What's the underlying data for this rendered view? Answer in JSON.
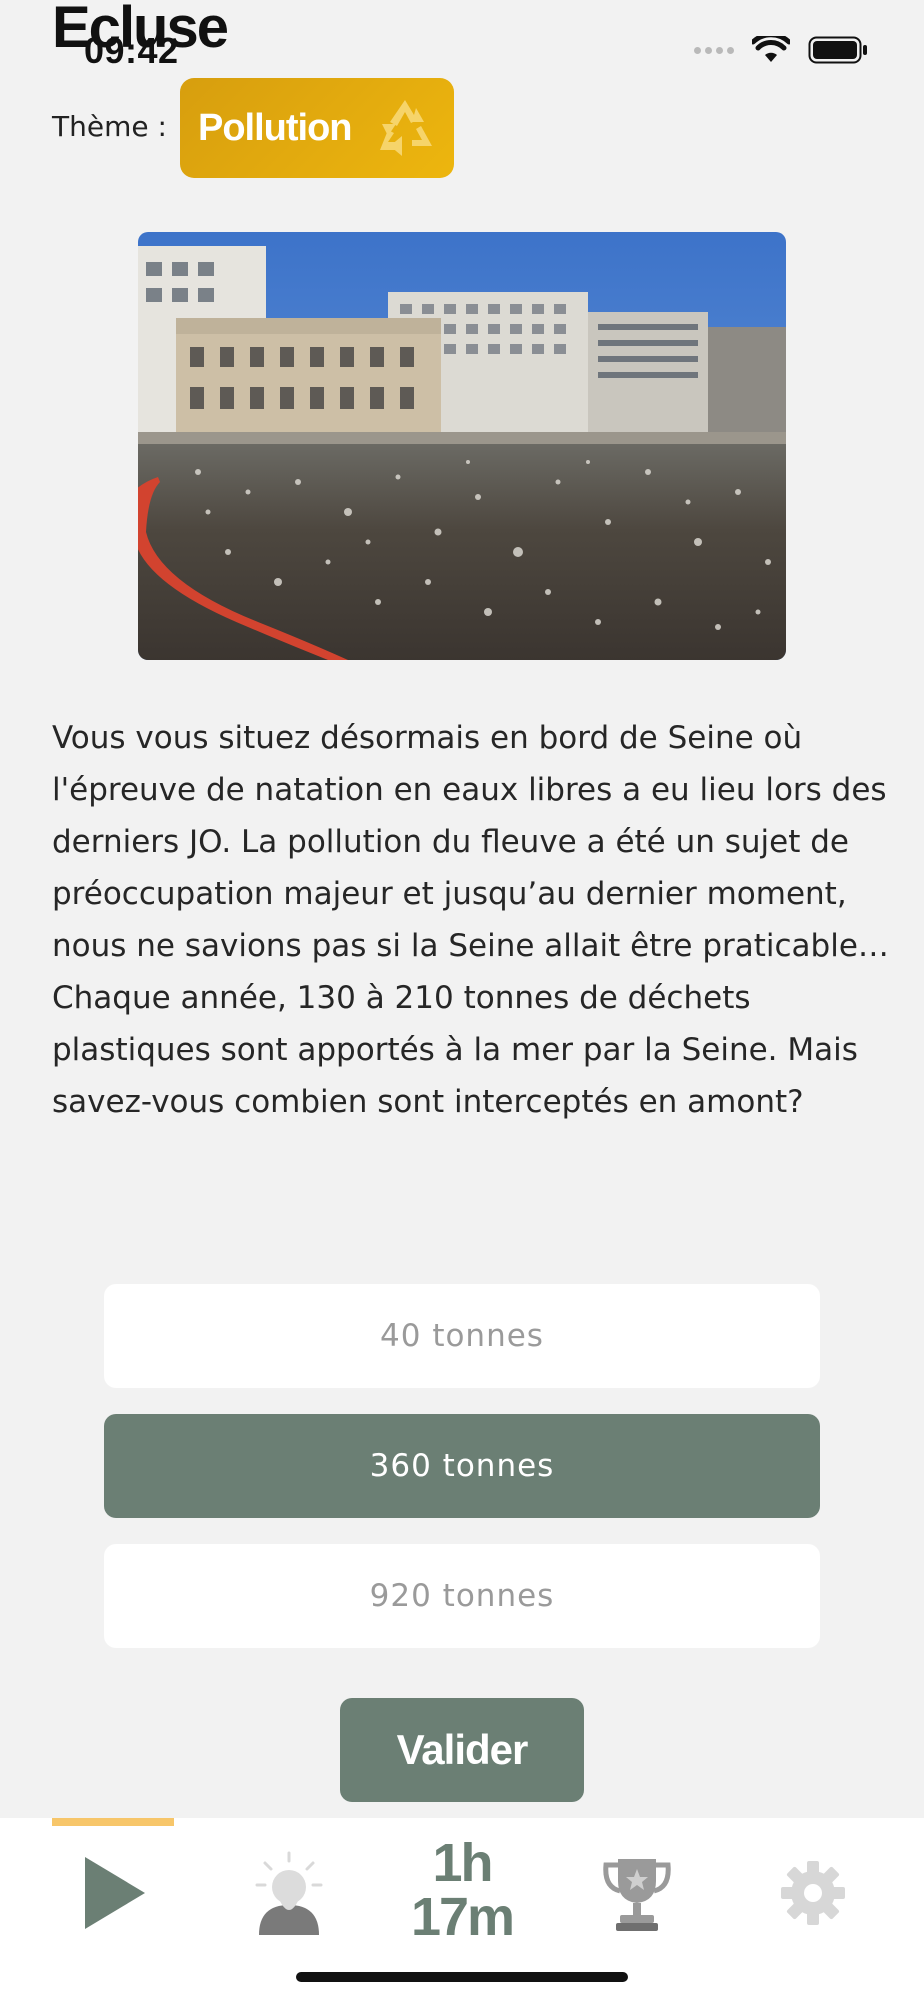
{
  "status_bar": {
    "time": "09:42",
    "signal_icon": "signal-dots-icon",
    "wifi_icon": "wifi-icon",
    "battery_icon": "battery-icon"
  },
  "header": {
    "title": "Ecluse"
  },
  "theme": {
    "label": "Thème :",
    "badge_text": "Pollution",
    "badge_icon": "recycle-icon",
    "badge_color": "#e5ab0e"
  },
  "image": {
    "subject": "canal-lock-photo"
  },
  "description": {
    "paragraph_1": "Vous vous situez désormais en bord de Seine où l'épreuve de natation en eaux libres a eu lieu lors des derniers JO. La pollution du fleuve a été un sujet de préoccupation majeur et jusqu’au dernier moment, nous ne savions pas si la Seine allait être praticable…",
    "paragraph_2": "Chaque année, 130 à 210 tonnes de déchets plastiques sont apportés à la mer par la Seine. Mais savez-vous combien sont interceptés en amont?"
  },
  "answers": [
    {
      "label": "40 tonnes",
      "selected": false
    },
    {
      "label": "360 tonnes",
      "selected": true
    },
    {
      "label": "920 tonnes",
      "selected": false
    }
  ],
  "validate_button": {
    "label": "Valider"
  },
  "tab_bar": {
    "active_indicator_color": "#f7c66a",
    "accent_color": "#6b7f74",
    "timer_hours": "1h",
    "timer_minutes": "17m",
    "tabs": [
      {
        "icon": "play-icon",
        "active": true
      },
      {
        "icon": "hint-person-icon",
        "active": false
      },
      {
        "icon": "timer",
        "active": false
      },
      {
        "icon": "trophy-icon",
        "active": false
      },
      {
        "icon": "gear-icon",
        "active": false
      }
    ]
  }
}
